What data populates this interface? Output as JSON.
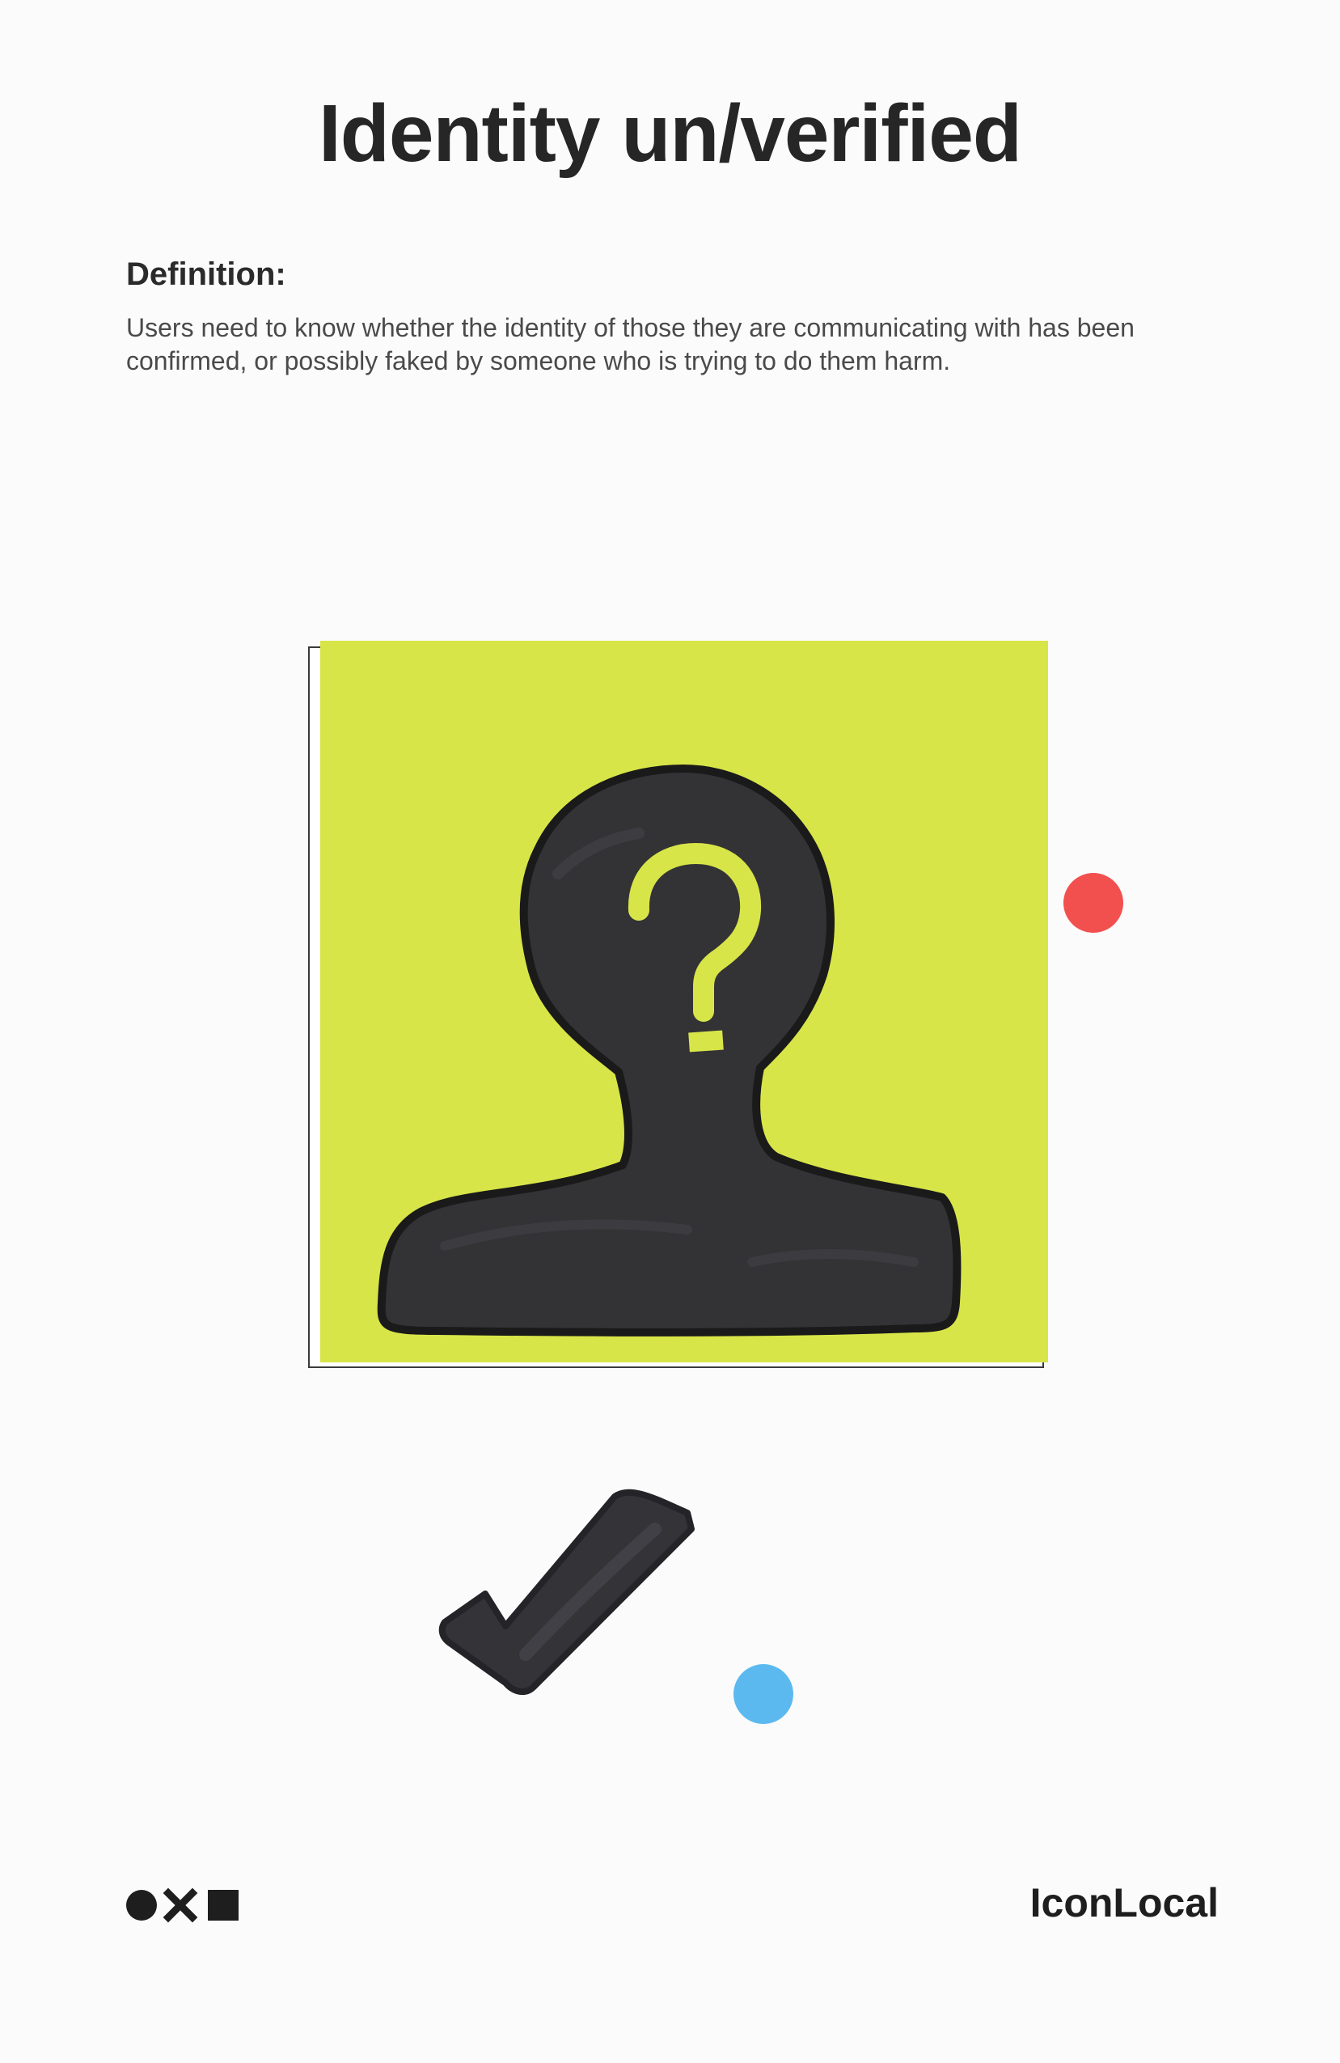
{
  "page": {
    "title": "Identity un/verified",
    "definition_heading": "Definition:",
    "definition_text": "Users need to know whether the identity of those they are communicating with has been confirmed, or possibly faked by someone who is trying to do them harm.",
    "brand": "IconLocal"
  },
  "illustrations": {
    "card": "unverified-person-sketch",
    "mark": "checkmark-sketch",
    "logo_shapes": [
      "circle-icon",
      "x-icon",
      "square-icon"
    ]
  },
  "colors": {
    "sticky_note": "#d8e548",
    "ink": "#333333",
    "red_dot": "#f2504f",
    "blue_dot": "#5bb9f0",
    "text": "#262626"
  }
}
